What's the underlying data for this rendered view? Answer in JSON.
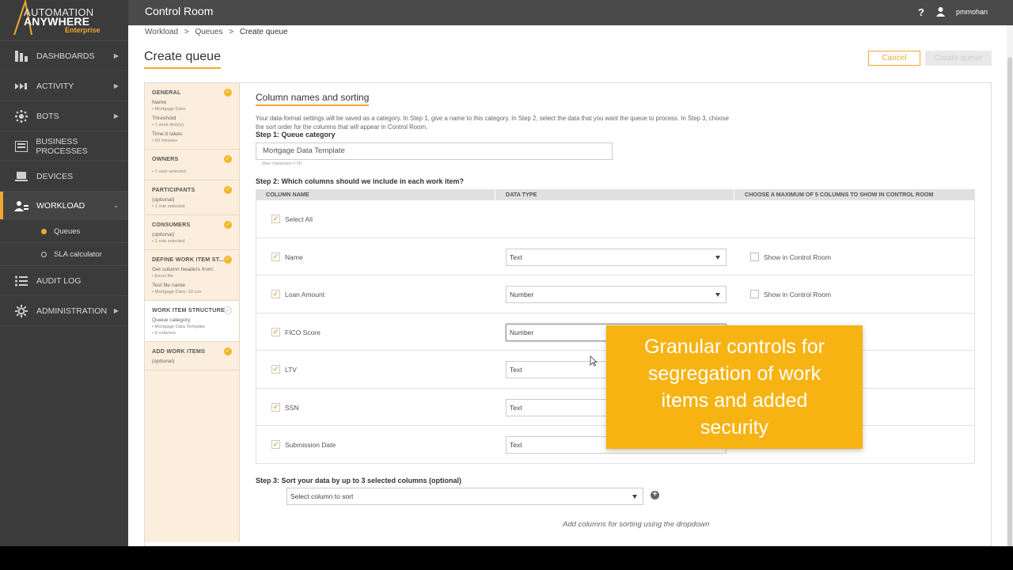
{
  "logo": {
    "line1": "AUTOMATION",
    "line2": "ANYWHERE",
    "line3": "Enterprise"
  },
  "topbar": {
    "title": "Control Room",
    "help": "?",
    "user": "pmmohan"
  },
  "sidebar": {
    "items": [
      {
        "label": "DASHBOARDS",
        "icon": "dashboard-icon"
      },
      {
        "label": "ACTIVITY",
        "icon": "activity-icon"
      },
      {
        "label": "BOTS",
        "icon": "bots-icon"
      },
      {
        "label": "BUSINESS PROCESSES",
        "icon": "business-process-icon"
      },
      {
        "label": "DEVICES",
        "icon": "devices-icon"
      },
      {
        "label": "WORKLOAD",
        "icon": "workload-icon"
      },
      {
        "label": "AUDIT LOG",
        "icon": "audit-log-icon"
      },
      {
        "label": "ADMINISTRATION",
        "icon": "administration-icon"
      }
    ],
    "subitems": [
      {
        "label": "Queues"
      },
      {
        "label": "SLA calculator"
      }
    ]
  },
  "breadcrumb": {
    "items": [
      "Workload",
      "Queues",
      "Create queue"
    ],
    "sep": ">"
  },
  "page": {
    "title": "Create queue",
    "cancel": "Cancel",
    "create": "Create queue"
  },
  "steps": [
    {
      "title": "GENERAL",
      "lines": [
        {
          "label": "Name",
          "sub": "• Mortgage Data"
        },
        {
          "label": "Threshold",
          "sub": "• 1 work item(s)"
        },
        {
          "label": "Time it takes",
          "sub": "• 60 minutes"
        }
      ]
    },
    {
      "title": "OWNERS",
      "lines": [
        {
          "label": "",
          "sub": "• 1 user selected"
        }
      ]
    },
    {
      "title": "PARTICIPANTS",
      "lines": [
        {
          "label": "(optional)",
          "sub": "• 1 role selected"
        }
      ]
    },
    {
      "title": "CONSUMERS",
      "lines": [
        {
          "label": "(optional)",
          "sub": "• 1 role selected"
        }
      ]
    },
    {
      "title": "DEFINE WORK ITEM ST...",
      "lines": [
        {
          "label": "Get column headers from:",
          "sub": "• Excel file"
        },
        {
          "label": "Test file name",
          "sub": "• Mortgage Data -10.csv"
        }
      ]
    },
    {
      "title": "WORK ITEM STRUCTURE",
      "lines": [
        {
          "label": "Queue category",
          "sub": "• Mortgage Data Template"
        },
        {
          "label": "",
          "sub": "• 6 columns"
        }
      ]
    },
    {
      "title": "ADD WORK ITEMS",
      "lines": [
        {
          "label": "(optional)",
          "sub": ""
        }
      ]
    }
  ],
  "content": {
    "section_title": "Column names and sorting",
    "description": "Your data-format settings will be saved as a category. In Step 1, give a name to this category. In Step 2, select the data that you want the queue to process. In Step 3, choose the sort order for the columns that will appear in Control Room.",
    "step1": "Step 1: Queue category",
    "category_value": "Mortgage Data Template",
    "max_chars": "Max characters = 50",
    "step2": "Step 2: Which columns should we include in each work item?",
    "headers": [
      "COLUMN NAME",
      "DATA TYPE",
      "CHOOSE A MAXIMUM OF 5 COLUMNS TO SHOW IN CONTROL ROOM"
    ],
    "select_all": "Select All",
    "rows": [
      {
        "name": "Name",
        "type": "Text",
        "show": "Show in Control Room"
      },
      {
        "name": "Loan Amount",
        "type": "Number",
        "show": "Show in Control Room"
      },
      {
        "name": "FICO Score",
        "type": "Number",
        "show": ""
      },
      {
        "name": "LTV",
        "type": "Text",
        "show": ""
      },
      {
        "name": "SSN",
        "type": "Text",
        "show": ""
      },
      {
        "name": "Submission Date",
        "type": "Text",
        "show": ""
      }
    ],
    "step3": "Step 3: Sort your data by up to 3 selected columns (optional)",
    "sort_placeholder": "Select column to sort",
    "sort_hint": "Add columns for sorting using the dropdown"
  },
  "callout": {
    "line1": "Granular controls for",
    "line2": "segregation of work",
    "line3": "items and added",
    "line4": "security"
  },
  "colors": {
    "accent": "#f0a830",
    "callout": "#f6b312",
    "sidebar": "#3b3b3b",
    "topbar": "#4a4a4a"
  }
}
